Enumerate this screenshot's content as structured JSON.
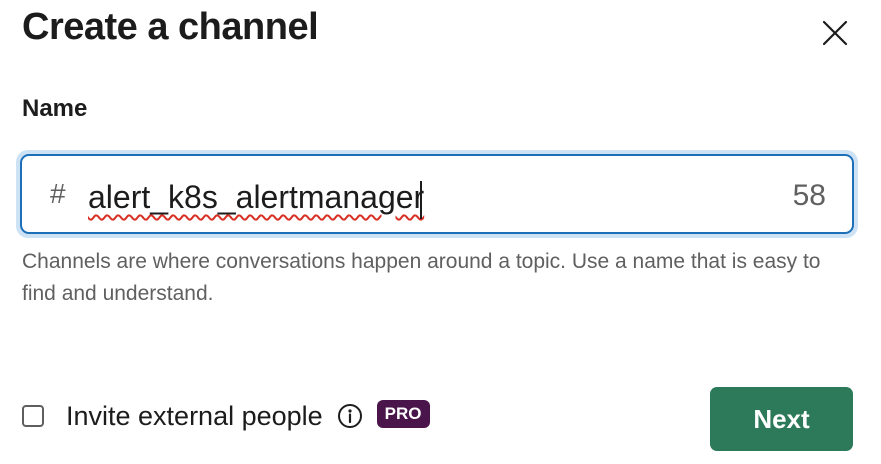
{
  "dialog": {
    "title": "Create a channel",
    "close_icon": "close-icon"
  },
  "name_field": {
    "label": "Name",
    "prefix": "#",
    "value": "alert_k8s_alertmanager",
    "remaining_chars": "58",
    "helper_text": "Channels are where conversations happen around a topic. Use a name that is easy to find and understand."
  },
  "footer": {
    "invite_checked": false,
    "invite_label": "Invite external people",
    "info_icon": "info-icon",
    "badge": "PRO",
    "next_label": "Next"
  },
  "colors": {
    "focus_border": "#1d6fb8",
    "focus_ring": "#cde3f5",
    "pro_badge": "#4a154b",
    "primary_button": "#2d7a5a",
    "spellcheck_underline": "#d93025"
  }
}
